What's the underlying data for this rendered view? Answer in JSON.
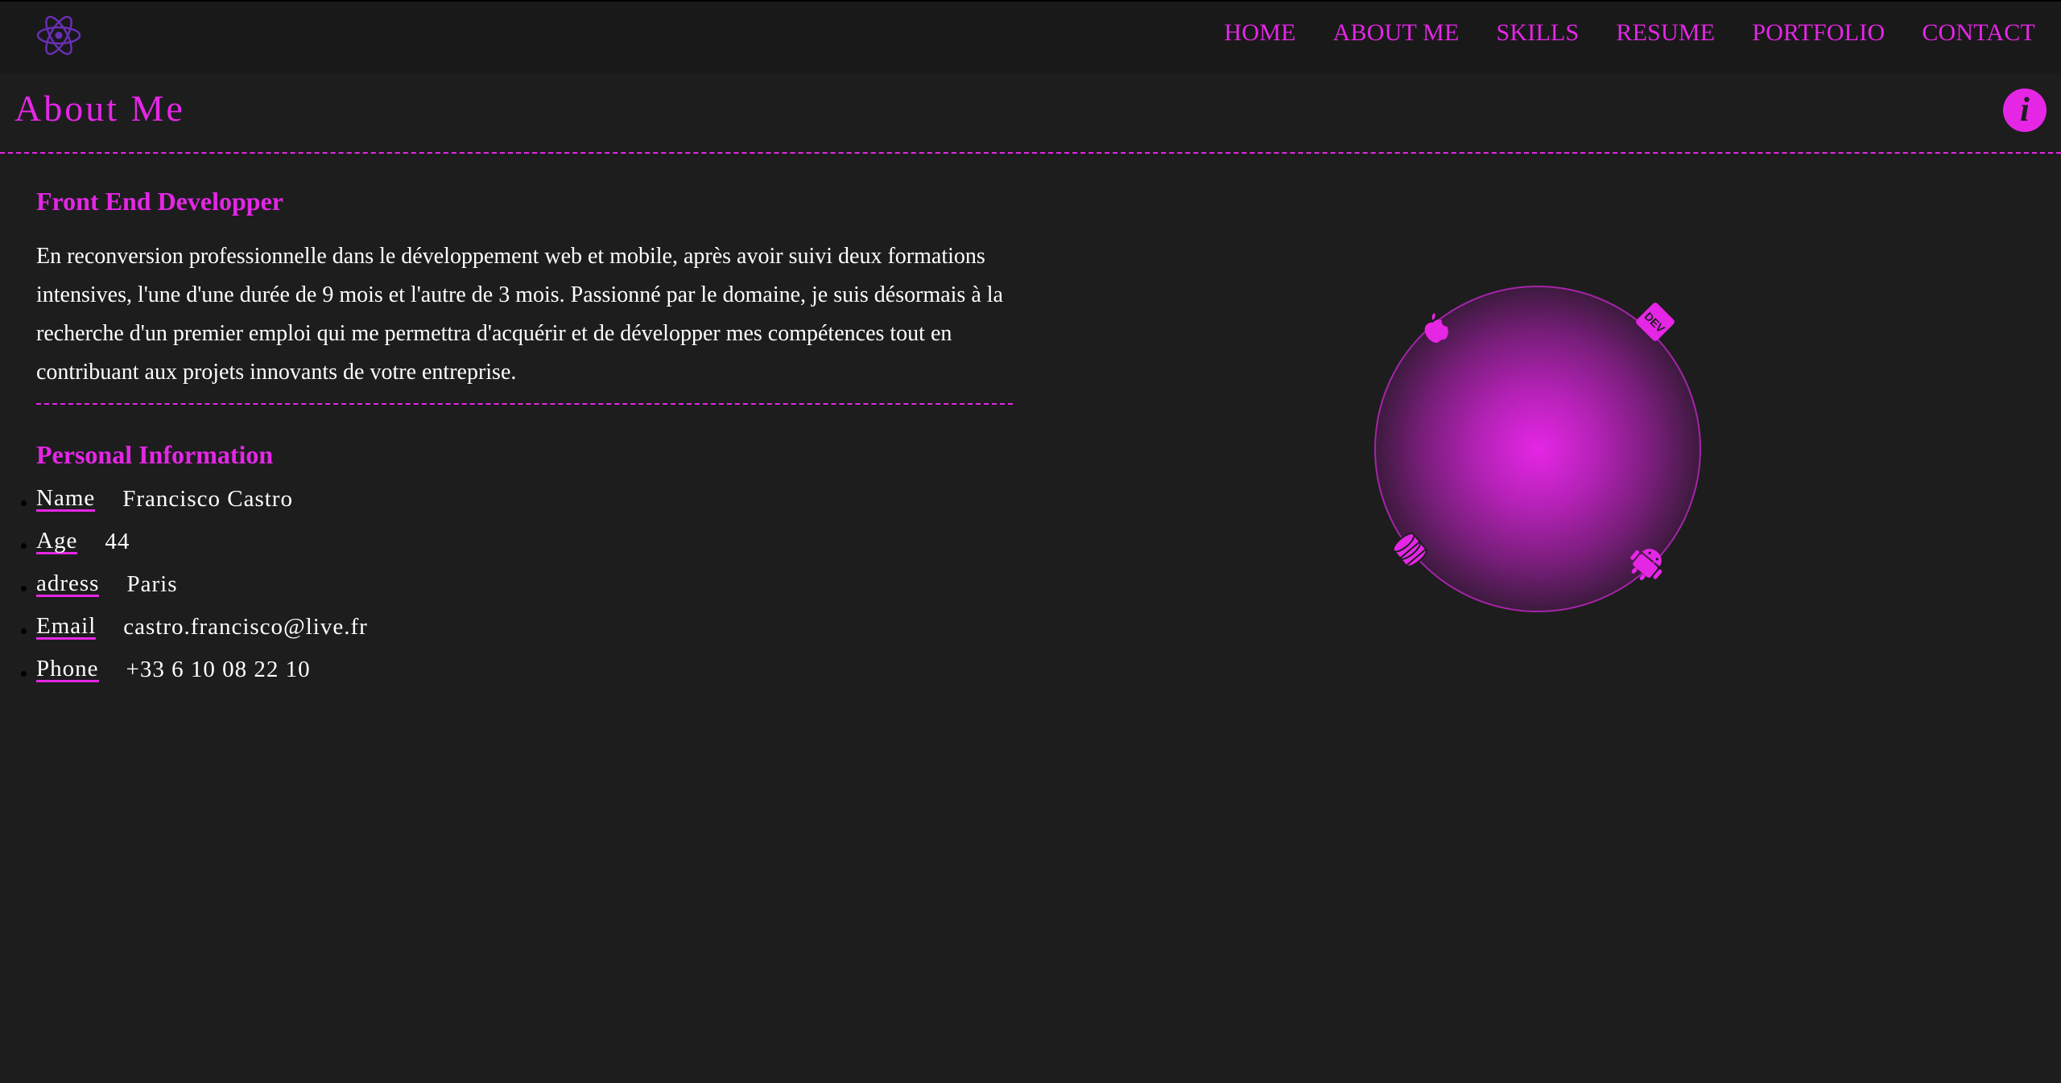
{
  "colors": {
    "accent": "#e526e5",
    "background": "#1d1d1e",
    "topbar": "#191919",
    "text": "#ffffff"
  },
  "nav": {
    "logo_icon": "react-atom-icon",
    "items": [
      "HOME",
      "ABOUT ME",
      "SKILLS",
      "RESUME",
      "PORTFOLIO",
      "CONTACT"
    ]
  },
  "page": {
    "title": "About Me",
    "info_icon": "info-icon",
    "info_glyph": "i"
  },
  "intro": {
    "heading": "Front End Developper",
    "bio": "En reconversion professionnelle dans le développement web et mobile, après avoir suivi deux formations intensives, l'une d'une durée de 9 mois et l'autre de 3 mois. Passionné par le domaine, je suis désormais à la recherche d'un premier emploi qui me permettra d'acquérir et de développer mes compétences tout en contribuant aux projets innovants de votre entreprise."
  },
  "personal": {
    "heading": "Personal Information",
    "items": [
      {
        "label": "Name",
        "value": "Francisco Castro"
      },
      {
        "label": "Age",
        "value": "44"
      },
      {
        "label": "adress",
        "value": "Paris"
      },
      {
        "label": "Email",
        "value": "castro.francisco@live.fr"
      },
      {
        "label": "Phone",
        "value": "+33 6 10 08 22 10"
      }
    ]
  },
  "orbit": {
    "icons": [
      "apple-icon",
      "dev-icon",
      "database-icon",
      "android-icon"
    ],
    "dev_badge_text": "DEV"
  }
}
